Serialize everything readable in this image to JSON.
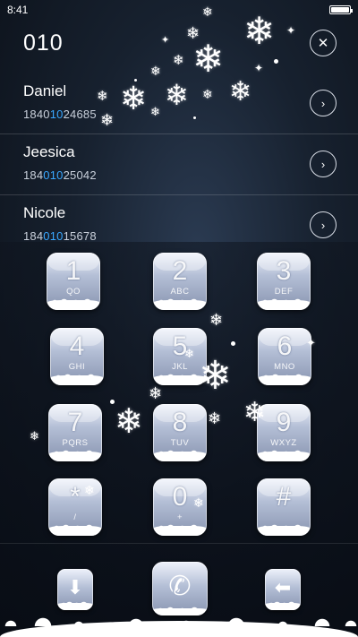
{
  "status_bar": {
    "time": "8:41",
    "battery_level": 1.0
  },
  "dialer": {
    "number": "010",
    "clear_icon": "close-icon"
  },
  "contacts": [
    {
      "name": "Daniel",
      "number_prefix": "1840",
      "number_match": "10",
      "number_suffix": "24685",
      "arrow_icon": "chevron-right-icon"
    },
    {
      "name": "Jeesica",
      "number_prefix": "184",
      "number_match": "010",
      "number_suffix": "25042",
      "arrow_icon": "chevron-right-icon"
    },
    {
      "name": "Nicole",
      "number_prefix": "184",
      "number_match": "010",
      "number_suffix": "15678",
      "arrow_icon": "chevron-right-icon"
    }
  ],
  "keypad": {
    "keys": [
      {
        "digit": "1",
        "letters": "QO"
      },
      {
        "digit": "2",
        "letters": "ABC"
      },
      {
        "digit": "3",
        "letters": "DEF"
      },
      {
        "digit": "4",
        "letters": "GHI"
      },
      {
        "digit": "5",
        "letters": "JKL"
      },
      {
        "digit": "6",
        "letters": "MNO"
      },
      {
        "digit": "7",
        "letters": "PQRS"
      },
      {
        "digit": "8",
        "letters": "TUV"
      },
      {
        "digit": "9",
        "letters": "WXYZ"
      },
      {
        "digit": "*",
        "letters": "/"
      },
      {
        "digit": "0",
        "letters": "+"
      },
      {
        "digit": "#",
        "letters": ""
      }
    ]
  },
  "actions": {
    "hide_keypad_icon": "arrow-down-icon",
    "call_icon": "phone-icon",
    "backspace_icon": "backspace-icon"
  },
  "theme": {
    "accent": "#39a7ff",
    "background": "#17212f",
    "key_color": "#b4bfd6"
  }
}
